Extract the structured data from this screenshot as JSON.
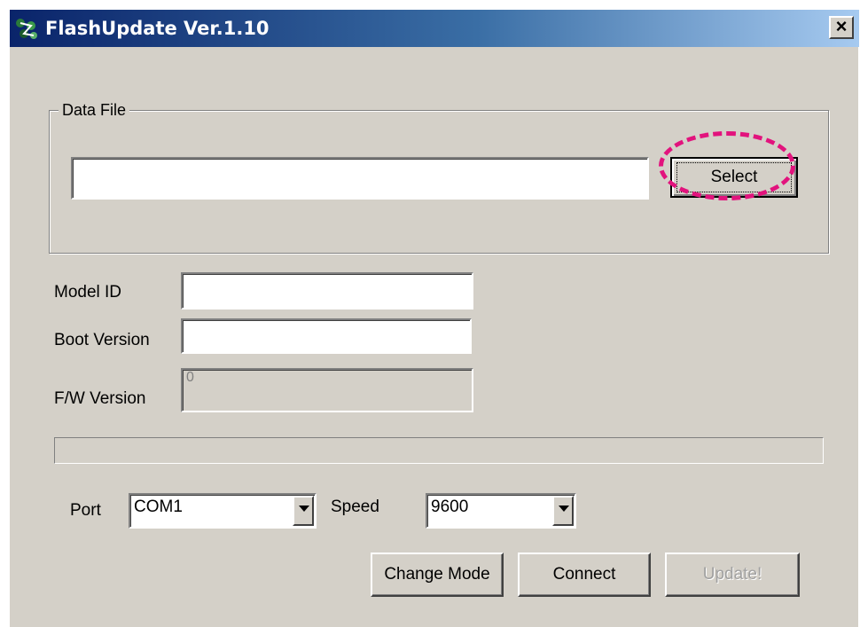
{
  "window": {
    "title": "FlashUpdate Ver.1.10",
    "close_label": "×"
  },
  "data_file": {
    "legend": "Data File",
    "path_value": "",
    "select_label": "Select"
  },
  "fields": {
    "model_id": {
      "label": "Model ID",
      "value": ""
    },
    "boot_version": {
      "label": "Boot Version",
      "value": ""
    },
    "fw_version": {
      "label": "F/W Version",
      "value": "0"
    }
  },
  "progress": {
    "fraction": 0
  },
  "port": {
    "label": "Port",
    "selected": "COM1"
  },
  "speed": {
    "label": "Speed",
    "selected": "9600"
  },
  "buttons": {
    "change_mode": "Change Mode",
    "connect": "Connect",
    "update": "Update!"
  },
  "colors": {
    "highlight": "#e2137d",
    "title_start": "#0a246a",
    "face": "#d4d0c8"
  }
}
